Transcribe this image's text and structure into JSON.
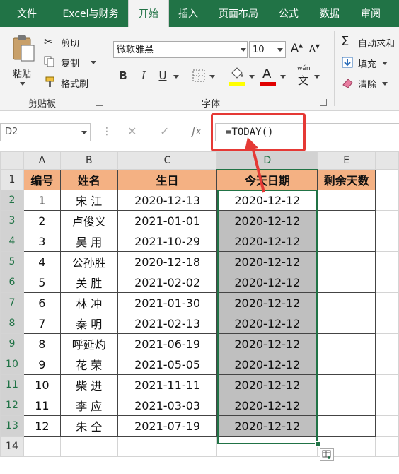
{
  "tabs": [
    "文件",
    "Excel与财务",
    "开始",
    "插入",
    "页面布局",
    "公式",
    "数据",
    "审阅"
  ],
  "ribbon": {
    "clipboard": {
      "paste": "粘贴",
      "cut": "剪切",
      "copy": "复制",
      "format_painter": "格式刷",
      "label": "剪贴板"
    },
    "font": {
      "name": "微软雅黑",
      "size": "10",
      "bold": "B",
      "italic": "I",
      "underline": "U",
      "font_color": "A",
      "wen": "wén",
      "wen_char": "文",
      "label": "字体"
    },
    "editing": {
      "autosum": "自动求和",
      "fill": "填充",
      "clear": "清除"
    }
  },
  "formula_bar": {
    "name_box": "D2",
    "cancel": "✕",
    "enter": "✓",
    "fx": "fx",
    "formula": "=TODAY()"
  },
  "columns": [
    "A",
    "B",
    "C",
    "D",
    "E"
  ],
  "selected_column": "D",
  "headers": [
    "编号",
    "姓名",
    "生日",
    "今天日期",
    "剩余天数"
  ],
  "rows": [
    [
      "1",
      "宋  江",
      "2020-12-13",
      "2020-12-12",
      ""
    ],
    [
      "2",
      "卢俊义",
      "2021-01-01",
      "2020-12-12",
      ""
    ],
    [
      "3",
      "吴  用",
      "2021-10-29",
      "2020-12-12",
      ""
    ],
    [
      "4",
      "公孙胜",
      "2020-12-18",
      "2020-12-12",
      ""
    ],
    [
      "5",
      "关  胜",
      "2021-02-02",
      "2020-12-12",
      ""
    ],
    [
      "6",
      "林  冲",
      "2021-01-30",
      "2020-12-12",
      ""
    ],
    [
      "7",
      "秦  明",
      "2021-02-13",
      "2020-12-12",
      ""
    ],
    [
      "8",
      "呼延灼",
      "2021-06-19",
      "2020-12-12",
      ""
    ],
    [
      "9",
      "花  荣",
      "2021-05-05",
      "2020-12-12",
      ""
    ],
    [
      "10",
      "柴  进",
      "2021-11-11",
      "2020-12-12",
      ""
    ],
    [
      "11",
      "李  应",
      "2021-03-03",
      "2020-12-12",
      ""
    ],
    [
      "12",
      "朱  仝",
      "2021-07-19",
      "2020-12-12",
      ""
    ]
  ],
  "row_numbers": [
    "1",
    "2",
    "3",
    "4",
    "5",
    "6",
    "7",
    "8",
    "9",
    "10",
    "11",
    "12",
    "13",
    "14"
  ],
  "colors": {
    "accent": "#217346",
    "header_fill": "#f4b183",
    "selection_fill": "#bfbfbf",
    "annotation": "#e53935"
  }
}
